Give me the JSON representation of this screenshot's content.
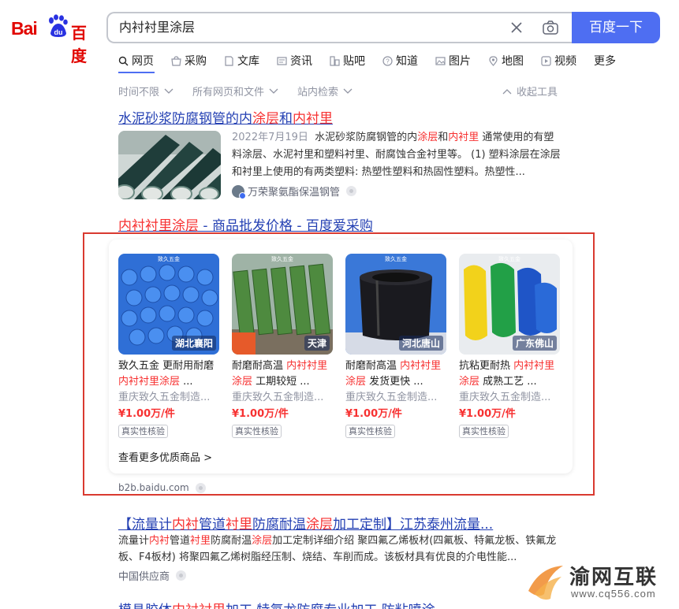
{
  "logo": {
    "text_left": "Bai",
    "text_paw": "du",
    "text_right": "百度"
  },
  "search": {
    "query": "内衬衬里涂层",
    "button_label": "百度一下"
  },
  "tabs": [
    {
      "label": "网页",
      "icon": "search-icon"
    },
    {
      "label": "采购",
      "icon": "shop-icon"
    },
    {
      "label": "文库",
      "icon": "document-icon"
    },
    {
      "label": "资讯",
      "icon": "news-icon"
    },
    {
      "label": "贴吧",
      "icon": "forum-icon"
    },
    {
      "label": "知道",
      "icon": "question-icon"
    },
    {
      "label": "图片",
      "icon": "image-icon"
    },
    {
      "label": "地图",
      "icon": "map-icon"
    },
    {
      "label": "视频",
      "icon": "video-icon"
    },
    {
      "label": "更多",
      "icon": ""
    }
  ],
  "filters": {
    "time": "时间不限",
    "type": "所有网页和文件",
    "site": "站内检索",
    "collapse": "收起工具"
  },
  "result1": {
    "title_a": "水泥砂浆防腐钢管的内",
    "title_b": "涂层",
    "title_c": "和",
    "title_d": "内衬里",
    "date": "2022年7月19日",
    "abs_a": "水泥砂浆防腐钢管的内",
    "abs_b": "涂层",
    "abs_c": "和",
    "abs_d": "内衬里",
    "abs_e": " 通常使用的有塑料涂层、水泥衬里和塑料衬里、耐腐蚀合金衬里等。 (1) 塑料涂层在涂层和衬里上使用的有两类塑料: 热塑性塑料和热固性塑料。热塑性...",
    "source": "万荣聚氨酯保温钢管"
  },
  "result2": {
    "title_a": "内衬衬里涂层",
    "title_b": " - 商品批发价格 - 百度爱采购",
    "see_more": "查看更多优质商品 >",
    "url": "b2b.baidu.com",
    "products": [
      {
        "brand": "致久五金",
        "location": "湖北襄阳",
        "name_a": "致久五金 更耐用耐磨",
        "name_b": "内衬衬里涂层",
        "name_c": " ...",
        "company": "重庆致久五金制造...",
        "price": "¥1.00万/件",
        "badge": "真实性核验"
      },
      {
        "brand": "致久五金",
        "location": "天津",
        "name_a": "耐磨耐高温 ",
        "name_b": "内衬衬里涂层",
        "name_c": " 工期较短 ...",
        "company": "重庆致久五金制造...",
        "price": "¥1.00万/件",
        "badge": "真实性核验"
      },
      {
        "brand": "致久五金",
        "location": "河北唐山",
        "name_a": "耐磨耐高温 ",
        "name_b": "内衬衬里涂层",
        "name_c": " 发货更快 ...",
        "company": "重庆致久五金制造...",
        "price": "¥1.00万/件",
        "badge": "真实性核验"
      },
      {
        "brand": "致久五金",
        "location": "广东佛山",
        "name_a": "抗粘更耐热 ",
        "name_b": "内衬衬里涂层",
        "name_c": " 成熟工艺 ...",
        "company": "重庆致久五金制造...",
        "price": "¥1.00万/件",
        "badge": "真实性核验"
      }
    ]
  },
  "result3": {
    "title_a": "【流量计",
    "title_b": "内衬",
    "title_c": "管道",
    "title_d": "衬里",
    "title_e": "防腐耐温",
    "title_f": "涂层",
    "title_g": "加工定制】江苏泰州流量...",
    "abs_a": "流量计",
    "abs_b": "内衬",
    "abs_c": "管道",
    "abs_d": "衬里",
    "abs_e": "防腐耐温",
    "abs_f": "涂层",
    "abs_g": "加工定制详细介绍 聚四氟乙烯板材(四氟板、特氟龙板、铁氟龙板、F4板材) 将聚四氟乙烯树脂经压制、烧结、车削而成。该板材具有优良的介电性能...",
    "source": "中国供应商"
  },
  "result4": {
    "title_a": "模具胶体",
    "title_b": "内衬衬里",
    "title_c": "加工 特氟龙防腐专业加工 防粘喷涂"
  },
  "watermark": {
    "brand": "渝网互联",
    "url": "www.cq556.com"
  },
  "colors": {
    "accent": "#4e6ef2",
    "link": "#2440b3",
    "highlight": "#f73131",
    "frame": "#d93a30"
  }
}
